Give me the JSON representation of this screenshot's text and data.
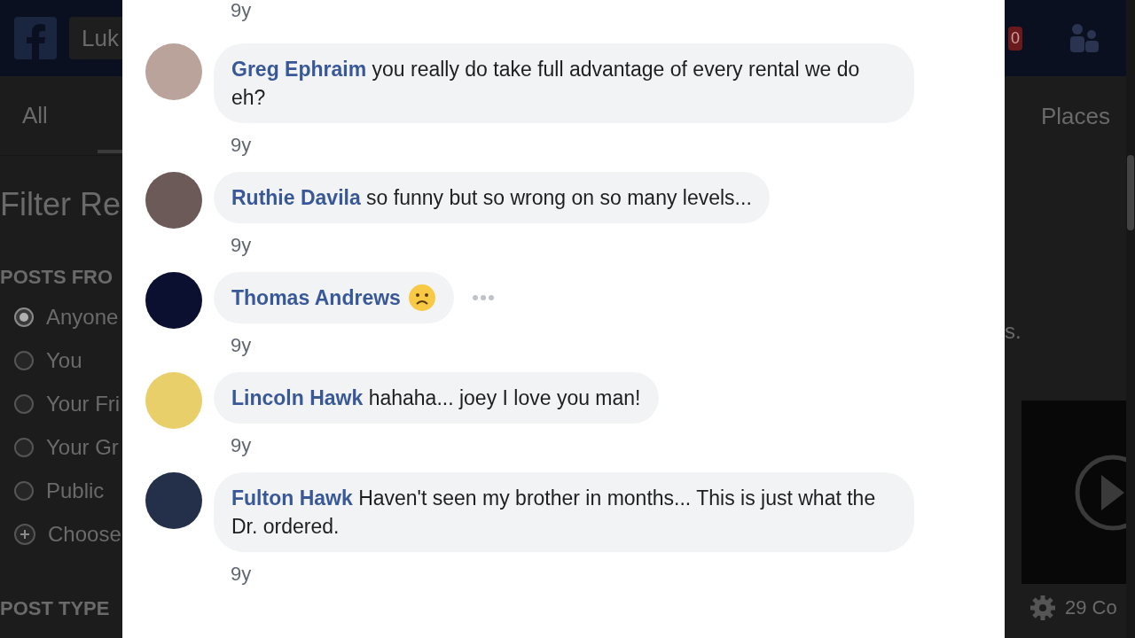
{
  "background": {
    "header": {
      "search": "Luk",
      "badge": "0"
    },
    "tabs": [
      {
        "label": "All",
        "selected": false
      },
      {
        "label": "Places",
        "selected": false
      }
    ],
    "filter_title": "Filter Re",
    "posts_from": {
      "heading": "POSTS FRO",
      "options": [
        {
          "label": "Anyone",
          "kind": "radio",
          "selected": true
        },
        {
          "label": "You",
          "kind": "radio",
          "selected": false
        },
        {
          "label": "Your Fri",
          "kind": "radio",
          "selected": false
        },
        {
          "label": "Your Gr",
          "kind": "radio",
          "selected": false
        },
        {
          "label": "Public",
          "kind": "radio",
          "selected": false
        },
        {
          "label": "Choose",
          "kind": "add",
          "selected": false
        }
      ]
    },
    "post_type_heading": "POST TYPE",
    "right_snippet": "s.",
    "comments_count": "29 Co"
  },
  "dialog": {
    "top_time": "9y",
    "comments": [
      {
        "author": "Greg Ephraim",
        "kind": "text",
        "text": "you really do take full advantage of every rental we do eh?",
        "time": "9y",
        "hovered": false
      },
      {
        "author": "Ruthie Davila",
        "kind": "text",
        "text": "so funny but so wrong on so many levels...",
        "time": "9y",
        "hovered": false
      },
      {
        "author": "Thomas Andrews",
        "kind": "emoji",
        "time": "9y",
        "hovered": true
      },
      {
        "author": "Lincoln Hawk",
        "kind": "text",
        "text": "hahaha... joey I love you man!",
        "time": "9y",
        "hovered": false
      },
      {
        "author": "Fulton Hawk",
        "kind": "text",
        "text": "Haven't seen my brother in months... This is just what the Dr. ordered.",
        "time": "9y",
        "hovered": false
      }
    ]
  }
}
